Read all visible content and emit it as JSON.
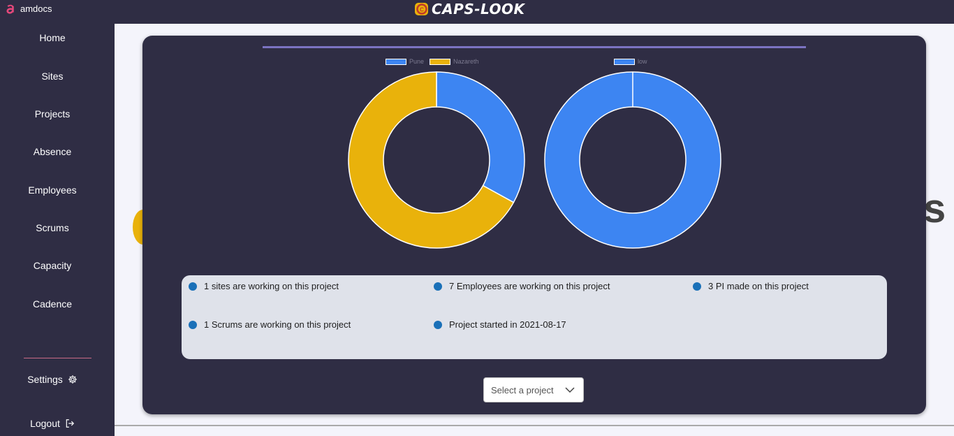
{
  "brand": {
    "name": "amdocs"
  },
  "app": {
    "title": "CAPS-LOOK"
  },
  "nav": {
    "items": [
      "Home",
      "Sites",
      "Projects",
      "Absence",
      "Employees",
      "Scrums",
      "Capacity",
      "Cadence"
    ],
    "settings": "Settings",
    "logout": "Logout"
  },
  "colors": {
    "background": "#2f2d44",
    "blue": "#3d85f2",
    "gold": "#e9b20b",
    "card": "#2f2d44",
    "info_panel": "#dfe2ea"
  },
  "charts": {
    "sites": {
      "legend": [
        "Pune",
        "Nazareth"
      ]
    },
    "priority": {
      "legend": [
        "low"
      ]
    }
  },
  "chart_data": [
    {
      "type": "pie",
      "labels": [
        "Pune",
        "Nazareth"
      ],
      "values": [
        33,
        67
      ],
      "colors": [
        "#3d85f2",
        "#e9b20b"
      ],
      "donut": true
    },
    {
      "type": "pie",
      "labels": [
        "low"
      ],
      "values": [
        100
      ],
      "colors": [
        "#3d85f2"
      ],
      "donut": true
    }
  ],
  "info": {
    "sites": "1 sites are working on this project",
    "employees": "7 Employees are working on this project",
    "pi": "3 PI made on this project",
    "scrums": "1 Scrums are working on this project",
    "started": "Project started in 2021-08-17"
  },
  "select": {
    "placeholder": "Select a project"
  }
}
